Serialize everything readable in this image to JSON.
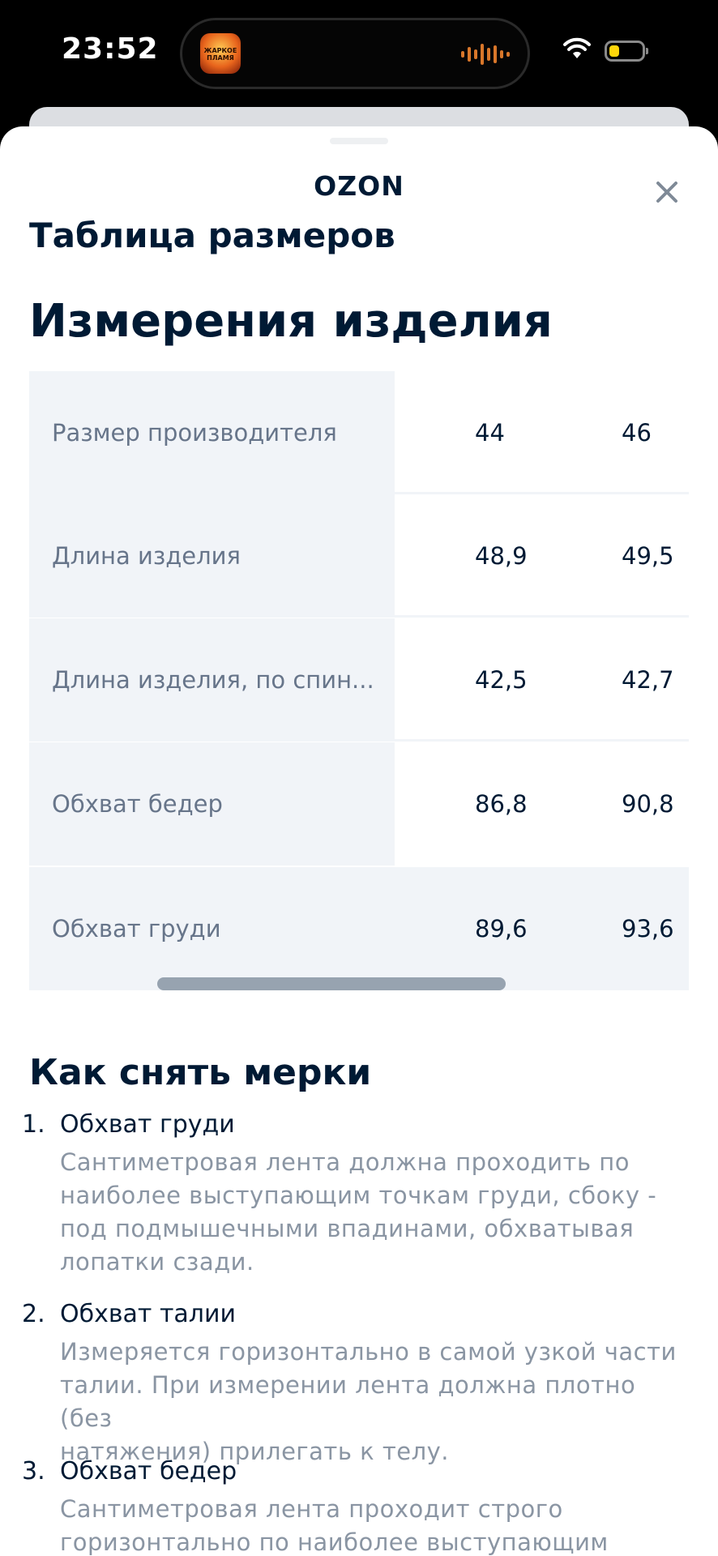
{
  "status_bar": {
    "time": "23:52",
    "island_app_label": "ЖАРКОЕ ПЛАМЯ",
    "battery_color": "#ffd60a"
  },
  "sheet": {
    "brand": "OZON",
    "title": "Таблица размеров"
  },
  "measurements": {
    "title": "Измерения изделия",
    "rows": [
      {
        "label": "Размер производителя",
        "values": [
          "44",
          "46"
        ]
      },
      {
        "label": "Длина изделия",
        "values": [
          "48,9",
          "49,5"
        ]
      },
      {
        "label": "Длина изделия, по спин...",
        "values": [
          "42,5",
          "42,7"
        ]
      },
      {
        "label": "Обхват бедер",
        "values": [
          "86,8",
          "90,8"
        ]
      },
      {
        "label": "Обхват груди",
        "values": [
          "89,6",
          "93,6"
        ]
      }
    ]
  },
  "how_to": {
    "title": "Как снять мерки",
    "steps": [
      {
        "num": "1.",
        "name": "Обхват груди",
        "lines": [
          "Сантиметровая лента должна проходить по",
          "наиболее выступающим точкам груди, сбоку -",
          "под подмышечными впадинами, обхватывая",
          "лопатки сзади."
        ]
      },
      {
        "num": "2.",
        "name": "Обхват талии",
        "lines": [
          "Измеряется горизонтально в самой узкой части",
          "талии. При измерении лента должна плотно (без",
          "натяжения) прилегать к телу."
        ]
      },
      {
        "num": "3.",
        "name": "Обхват бедер",
        "lines": [
          "Сантиметровая лента проходит строго",
          "горизонтально по наиболее выступающим"
        ]
      }
    ]
  },
  "colors": {
    "text_primary": "#001a34",
    "text_secondary": "#8a95a3",
    "label_bg": "#f1f4f8",
    "scrollbar": "#97a3b0"
  }
}
